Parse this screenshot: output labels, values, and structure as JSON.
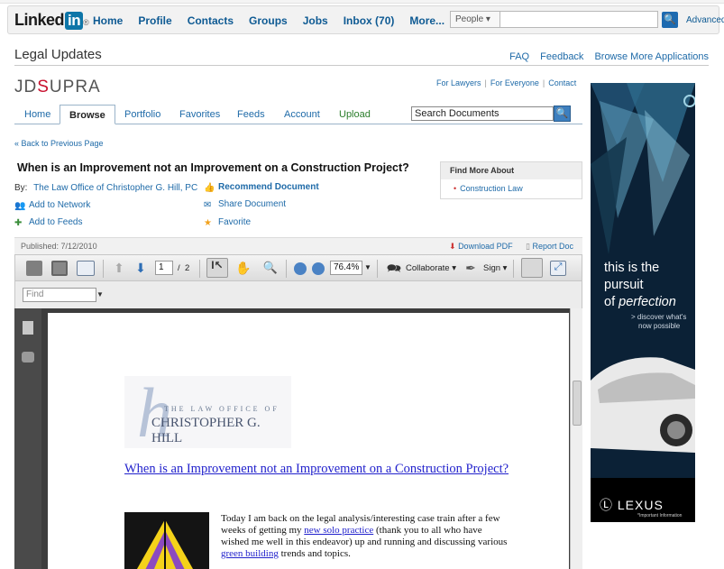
{
  "linkedin": {
    "logo_text": "Linked",
    "logo_in": "in",
    "logo_reg": "®",
    "nav": [
      "Home",
      "Profile",
      "Contacts",
      "Groups",
      "Jobs",
      "Inbox (70)",
      "More..."
    ],
    "search_scope": "People ▾",
    "search_go": "🔍",
    "advanced": "Advanced"
  },
  "app": {
    "title": "Legal Updates",
    "links": [
      "FAQ",
      "Feedback",
      "Browse More Applications"
    ]
  },
  "jdsupra": {
    "logo_left": "JD",
    "logo_s": "S",
    "logo_right": "UPRA",
    "top_links": [
      "For Lawyers",
      "For Everyone",
      "Contact"
    ],
    "tabs": [
      "Home",
      "Browse",
      "Portfolio",
      "Favorites",
      "Feeds",
      "Account",
      "Upload"
    ],
    "search_placeholder": "Search Documents",
    "back_link": "« Back to Previous Page",
    "doc_title": "When is an Improvement not an Improvement on a Construction Project?",
    "by_label": "By:",
    "author": "The Law Office of Christopher G. Hill, PC",
    "actions": {
      "recommend": "Recommend Document",
      "add_network": "Add to Network",
      "share": "Share Document",
      "add_feeds": "Add to Feeds",
      "favorite": "Favorite"
    },
    "find_more": {
      "heading": "Find More About",
      "item": "Construction Law"
    },
    "published": "Published: 7/12/2010",
    "download_pdf": "Download PDF",
    "report_doc": "Report Doc"
  },
  "viewer": {
    "page_current": "1",
    "page_sep": "/",
    "page_total": "2",
    "zoom": "76.4%",
    "collaborate": "Collaborate ▾",
    "sign": "Sign ▾",
    "find_placeholder": "Find",
    "find_dropdown": "▼"
  },
  "document": {
    "logo_line1": "THE LAW OFFICE OF",
    "logo_line2": "CHRISTOPHER G. HILL",
    "logo_letter": "h",
    "title": "When is an Improvement not an Improvement on a Construction Project?",
    "para_1": "Today I am back on the legal analysis/interesting case train after a few weeks of getting my ",
    "link_1": "new solo practice",
    "para_2": " (thank you to all who have wished me well in this endeavor) up and running and discussing various ",
    "link_2": "green building",
    "para_3": " trends and topics."
  },
  "ad": {
    "line1": "this is the",
    "line2": "pursuit",
    "line3_a": "of ",
    "line3_b": "perfection",
    "tagline_1": "> discover what's",
    "tagline_2": "now possible",
    "brand": "LEXUS",
    "sub": "*Important Information"
  },
  "colors": {
    "linkedin_blue": "#0e76a8",
    "link_blue": "#1e6aa8",
    "upload_green": "#2a7d2a",
    "jds_red": "#c8102e"
  }
}
